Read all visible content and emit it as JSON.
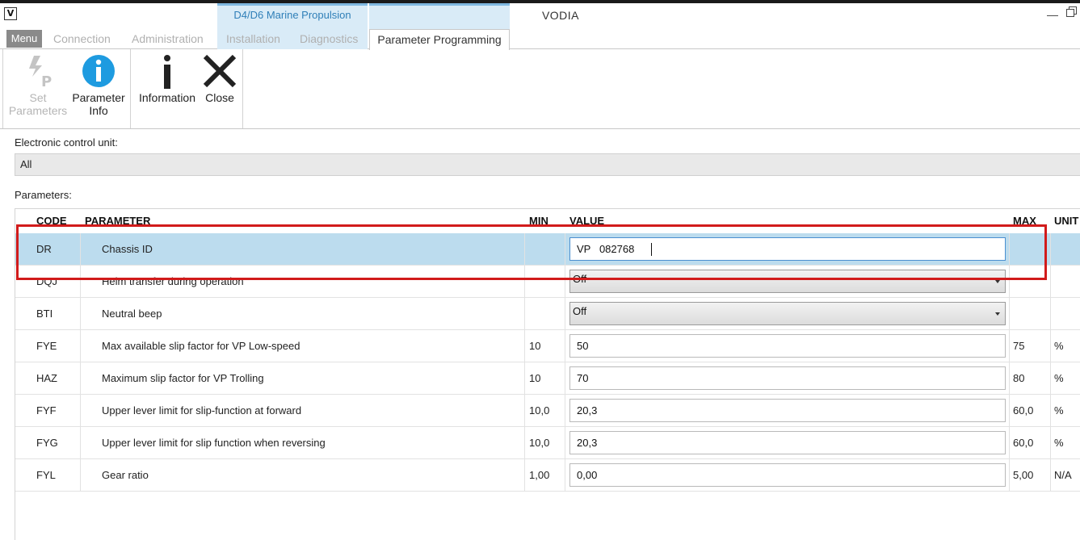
{
  "window": {
    "title": "VODIA",
    "app_icon": "vodia-logo-icon",
    "context_tab_group": "D4/D6 Marine Propulsion"
  },
  "tabs": {
    "menu": "Menu",
    "connection": "Connection",
    "administration": "Administration",
    "installation": "Installation",
    "diagnostics": "Diagnostics",
    "parameter_programming": "Parameter Programming"
  },
  "ribbon": {
    "set_parameters": "Set\nParameters",
    "parameter_info": "Parameter\nInfo",
    "information": "Information",
    "close": "Close"
  },
  "ecu": {
    "label": "Electronic control unit:",
    "selected": "All"
  },
  "parameters": {
    "label": "Parameters:",
    "columns": {
      "code": "CODE",
      "parameter": "PARAMETER",
      "min": "MIN",
      "value": "VALUE",
      "max": "MAX",
      "unit": "UNIT"
    },
    "rows": [
      {
        "code": "DR",
        "parameter": "Chassis ID",
        "min": "",
        "value": "VP   082768",
        "max": "",
        "unit": ""
      },
      {
        "code": "DQJ",
        "parameter": "Helm transfer during operation",
        "min": "",
        "value": "Off",
        "max": "",
        "unit": ""
      },
      {
        "code": "BTI",
        "parameter": "Neutral beep",
        "min": "",
        "value": "Off",
        "max": "",
        "unit": ""
      },
      {
        "code": "FYE",
        "parameter": "Max available slip factor for VP Low-speed",
        "min": "10",
        "value": "50",
        "max": "75",
        "unit": "%"
      },
      {
        "code": "HAZ",
        "parameter": "Maximum slip factor for VP Trolling",
        "min": "10",
        "value": "70",
        "max": "80",
        "unit": "%"
      },
      {
        "code": "FYF",
        "parameter": "Upper lever limit for slip-function at forward",
        "min": "10,0",
        "value": "20,3",
        "max": "60,0",
        "unit": "%"
      },
      {
        "code": "FYG",
        "parameter": "Upper lever limit for slip function when reversing",
        "min": "10,0",
        "value": "20,3",
        "max": "60,0",
        "unit": "%"
      },
      {
        "code": "FYL",
        "parameter": "Gear ratio",
        "min": "1,00",
        "value": "0,00",
        "max": "5,00",
        "unit": "N/A"
      }
    ]
  },
  "colors": {
    "selected_row": "#bcdcee",
    "highlight_border": "#d11b1b",
    "info_icon": "#1e9be0",
    "context_tab": "#d9ebf7"
  }
}
